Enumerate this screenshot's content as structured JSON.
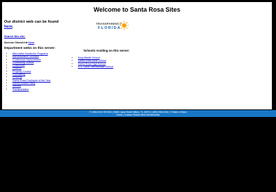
{
  "title": "Welcome to Santa Rosa Sites",
  "intro": {
    "line": "Our district web can be found",
    "link": "here"
  },
  "logo": {
    "top": "TRANSPARENCY",
    "bottom": "FLORIDA"
  },
  "search_link": "Search this site.",
  "classlink": {
    "prefix": "Access ClassLink",
    "link": "here"
  },
  "departments": {
    "heading": "Department webs on this server:",
    "items": [
      "Alternative Academic Programs",
      "Administrative Services",
      "Continuous Improvement",
      "Community School",
      "Curriculum",
      "Finance",
      "Property Control",
      "Purchasing",
      "Reading",
      "Santa Rosa Employee of the Year",
      "School Board Policy",
      "Service",
      "Transportation"
    ]
  },
  "schools": {
    "heading": "Schools residing on this server:",
    "items": [
      "King Middle School",
      "Santa Rosa Adult School",
      "Santa Rosa High School",
      "S.S. Dixon Intermediate School"
    ]
  },
  "footer": {
    "line1": "© 2006-2019 SRCSD  |  5086 Canal Street  Milton, FL  32570  |  (850) 983-5150  |  7:30am-4:30pm",
    "home": "Home",
    "contact": "Contact District Web Administrator"
  },
  "colors": {
    "footer_bg": "#1877c8",
    "link": "#0000cc"
  }
}
